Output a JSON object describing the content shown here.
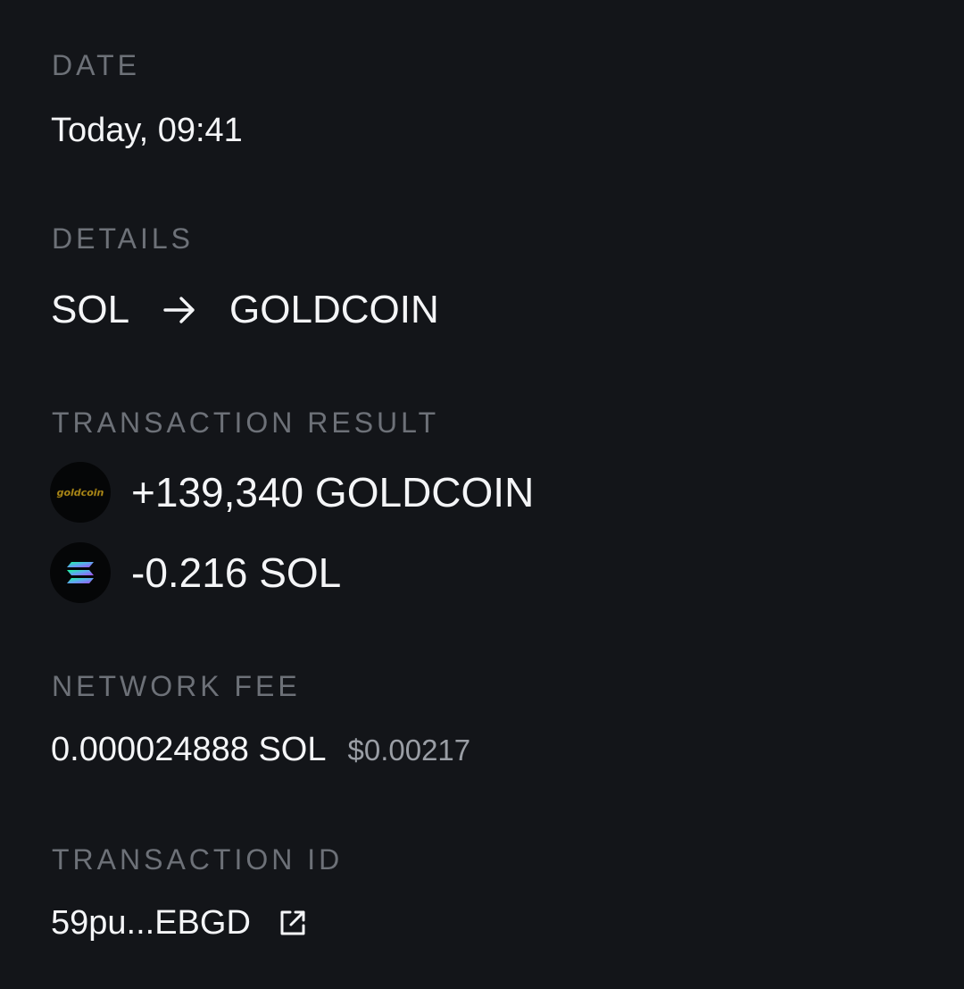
{
  "date": {
    "label": "DATE",
    "value": "Today, 09:41"
  },
  "details": {
    "label": "DETAILS",
    "from_token": "SOL",
    "to_token": "GOLDCOIN",
    "arrow_icon": "arrow-right-icon"
  },
  "transaction_result": {
    "label": "TRANSACTION RESULT",
    "items": [
      {
        "icon": "goldcoin-token-icon",
        "logo_text": "goldcoin",
        "text": "+139,340 GOLDCOIN"
      },
      {
        "icon": "solana-token-icon",
        "text": "-0.216 SOL"
      }
    ]
  },
  "network_fee": {
    "label": "NETWORK FEE",
    "sol": "0.000024888 SOL",
    "usd": "$0.00217"
  },
  "transaction_id": {
    "label": "TRANSACTION ID",
    "value": "59pu...EBGD",
    "link_icon": "external-link-icon"
  },
  "colors": {
    "background": "#131519",
    "label": "#6d7178",
    "text": "#f4f5f7",
    "secondary_text": "#9a9ea5",
    "gold": "#b08d1a"
  }
}
